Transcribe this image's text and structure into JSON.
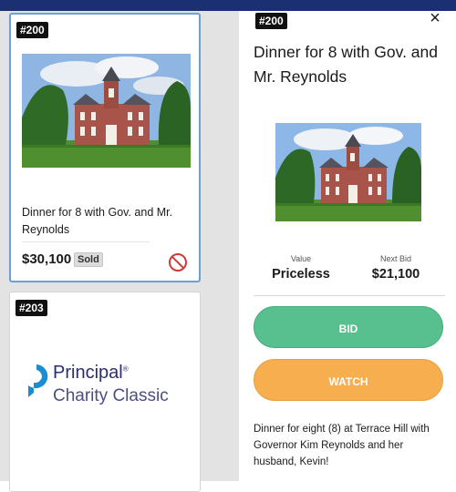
{
  "colors": {
    "top_bar": "#1b2f73",
    "bid_button": "#57c08e",
    "watch_button": "#f6ae4e",
    "selected_card_border": "#6e9ed8",
    "no_icon": "#cc3b3b"
  },
  "list": {
    "cards": [
      {
        "lot": "#200",
        "title": "Dinner for 8 with Gov. and Mr. Reynolds",
        "price": "$30,100",
        "status": "Sold",
        "icon": "prohibited-icon",
        "selected": true
      },
      {
        "lot": "#203",
        "logo": {
          "word": "Principal",
          "registered_mark": "®",
          "subtitle": "Charity Classic"
        }
      }
    ]
  },
  "detail": {
    "lot": "#200",
    "close_label": "×",
    "title": "Dinner for 8 with Gov. and Mr. Reynolds",
    "value_label": "Value",
    "value": "Priceless",
    "next_bid_label": "Next Bid",
    "next_bid": "$21,100",
    "bid_button": "BID",
    "watch_button": "WATCH",
    "description": "Dinner for eight (8) at Terrace Hill with Governor Kim Reynolds and her husband, Kevin!"
  }
}
